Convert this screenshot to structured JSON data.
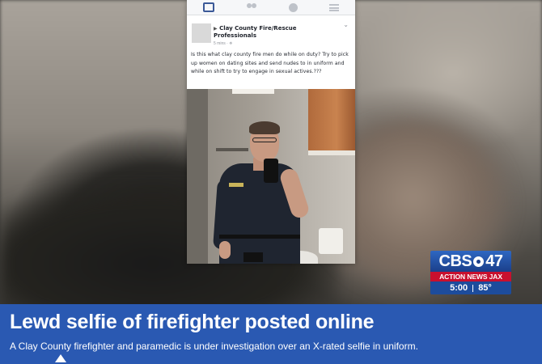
{
  "phone_post": {
    "author": "Clay County Fire/Rescue Professionals",
    "arrow": "▶",
    "time": "5 mins · ✵",
    "chevron": "⌄",
    "text": "Is this what clay county fire men do while on duty? Try to pick up women on dating sites and send nudes to in uniform and while on shift to try to engage in sexual actives.???",
    "nav_icons": [
      "home-icon",
      "friends-icon",
      "globe-icon",
      "menu-icon"
    ]
  },
  "logo": {
    "network": "CBS",
    "channel": "47",
    "brand": "ACTION NEWS JAX",
    "time": "5:00",
    "temperature": "85°",
    "colors": {
      "blue": "#2e67c2",
      "red": "#c8102e"
    }
  },
  "lower_third": {
    "headline": "Lewd selfie of firefighter posted online",
    "subline": "A Clay County firefighter and paramedic is under investigation over an X-rated selfie in uniform.",
    "background": "#2a59b2"
  }
}
